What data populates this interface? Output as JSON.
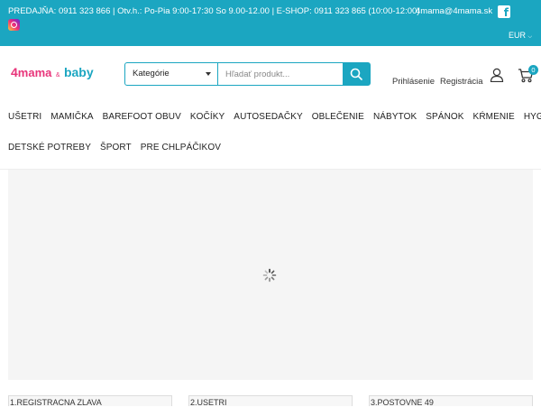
{
  "topbar": {
    "info": "PREDAJŇA: 0911 323 866 | Otv.h.: Po-Pia 9:00-17:30 So 9.00-12.00 | E-SHOP: 0911 323 865 (10:00-12:00)",
    "email": "4mama@4mama.sk",
    "currency": "EUR",
    "icons": [
      "facebook-icon",
      "instagram-icon"
    ]
  },
  "header": {
    "logo": {
      "num": "4",
      "mama": "mama",
      "amp": "&",
      "baby": "baby"
    },
    "search": {
      "category_label": "Kategórie",
      "placeholder": "Hľadať produkt..."
    },
    "login_label": "Prihlásenie",
    "register_label": "Registrácia",
    "cart_count": "0"
  },
  "nav": {
    "row1": [
      "UŠETRI",
      "MAMIČKA",
      "BAREFOOT OBUV",
      "KOČÍKY",
      "AUTOSEDAČKY",
      "OBLEČENIE",
      "NÁBYTOK",
      "SPÁNOK",
      "KŔMENIE",
      "HYGIENA"
    ],
    "row2": [
      "DETSKÉ POTREBY",
      "ŠPORT",
      "PRE CHLPÁČIKOV"
    ]
  },
  "tabs": [
    "1.REGISTRACNA ZLAVA",
    "2.USETRI",
    "3.POSTOVNE 49"
  ],
  "colors": {
    "accent": "#1ba6c1",
    "brand_pink": "#e8347a"
  }
}
